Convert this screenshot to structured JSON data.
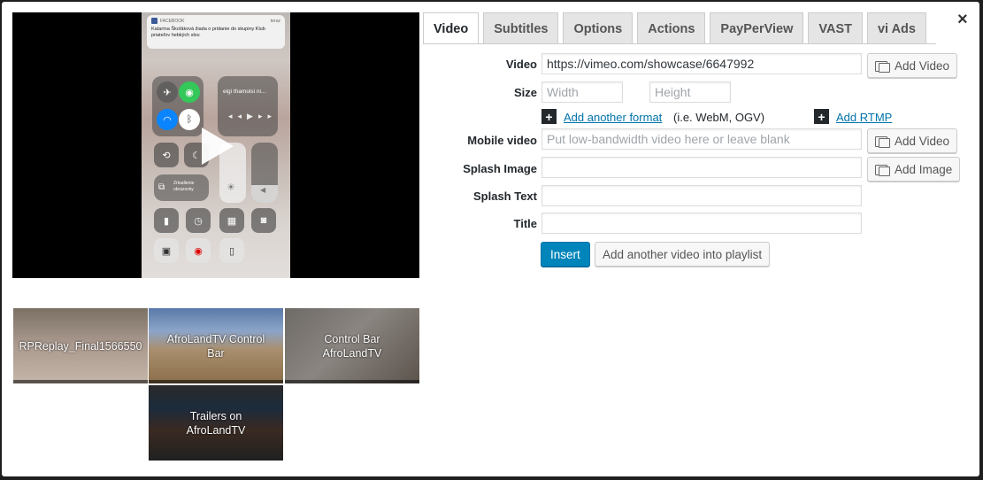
{
  "tabs": [
    {
      "label": "Video",
      "active": true
    },
    {
      "label": "Subtitles"
    },
    {
      "label": "Options"
    },
    {
      "label": "Actions"
    },
    {
      "label": "PayPerView"
    },
    {
      "label": "VAST"
    },
    {
      "label": "vi Ads"
    }
  ],
  "close_label": "×",
  "preview": {
    "notification_app": "FACEBOOK",
    "notification_time": "teraz",
    "notification_text": "Katarína Škoľáková žiada o pridanie do skupiny Klub priateľov hebkých slov.",
    "now_playing": "eigi thamoisi ni...",
    "mirroring_label": "Zrkadlenie obrazovky"
  },
  "playlist": [
    {
      "caption": "RPReplay_Final1566550"
    },
    {
      "caption": "AfroLandTV Control\nBar"
    },
    {
      "caption": "Control Bar\nAfroLandTV"
    },
    {
      "caption": "Trailers on\nAfroLandTV"
    }
  ],
  "form": {
    "video_label": "Video",
    "video_value": "https://vimeo.com/showcase/6647992",
    "add_video_label": "Add Video",
    "size_label": "Size",
    "width_placeholder": "Width",
    "height_placeholder": "Height",
    "add_format_plus": "+",
    "add_format_link": "Add another format",
    "add_format_note": "(i.e. WebM, OGV)",
    "add_rtmp_plus": "+",
    "add_rtmp_link": "Add RTMP",
    "mobile_label": "Mobile video",
    "mobile_placeholder": "Put low-bandwidth video here or leave blank",
    "add_mobile_video_label": "Add Video",
    "splash_image_label": "Splash Image",
    "splash_image_value": "",
    "add_image_label": "Add Image",
    "splash_text_label": "Splash Text",
    "splash_text_value": "",
    "title_label": "Title",
    "title_value": "",
    "insert_label": "Insert",
    "add_playlist_label": "Add another video into playlist"
  }
}
